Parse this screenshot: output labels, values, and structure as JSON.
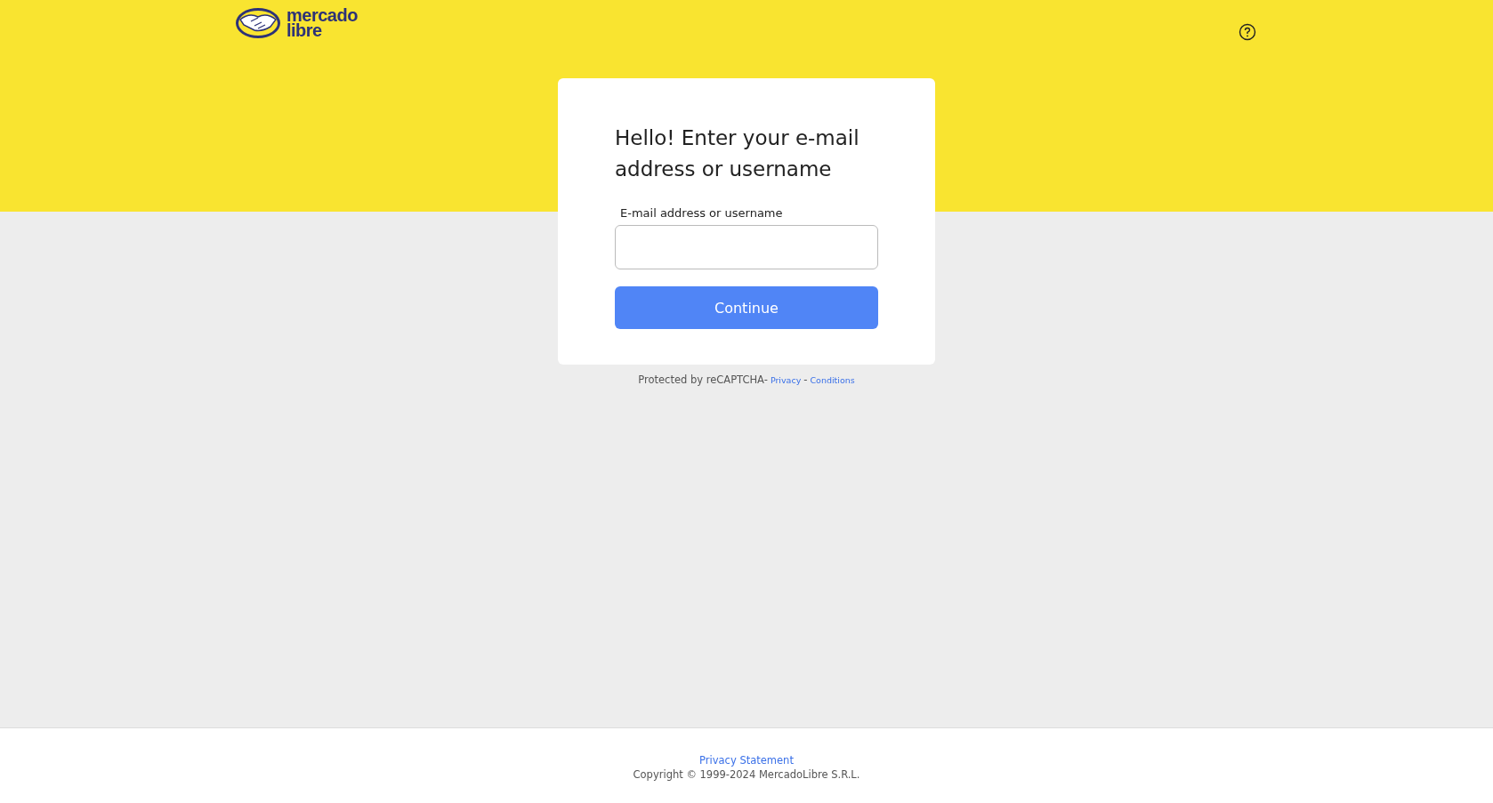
{
  "header": {
    "logo_lines": [
      "mercado",
      "libre"
    ]
  },
  "login_card": {
    "title": "Hello! Enter your e-mail address or username",
    "field": {
      "label": "E-mail address or username"
    },
    "button": "Continue"
  },
  "recaptcha": {
    "text": "Protected by reCAPTCHA-",
    "links": [
      "Privacy",
      "Conditions"
    ],
    "separator": "-"
  },
  "footer": {
    "link": "Privacy Statement",
    "copyright": "Copyright © 1999-2024 MercadoLibre S.R.L."
  }
}
